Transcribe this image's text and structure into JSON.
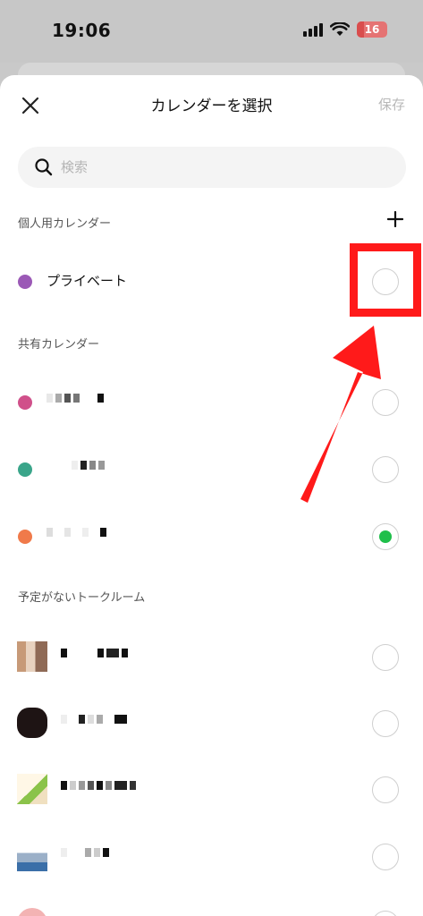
{
  "status_bar": {
    "time": "19:06",
    "battery": "16"
  },
  "header": {
    "title": "カレンダーを選択",
    "save_label": "保存"
  },
  "search": {
    "placeholder": "検索"
  },
  "sections": {
    "personal": "個人用カレンダー",
    "shared": "共有カレンダー",
    "no_schedule": "予定がないトークルーム"
  },
  "personal_calendars": [
    {
      "label": "プライベート",
      "color": "#9b59b6",
      "selected": false
    }
  ],
  "shared_calendar_colors": [
    "#d0508a",
    "#3aa58a",
    "#f07a4a"
  ],
  "shared_selected_index": 2,
  "icons": [
    "close-icon",
    "search-icon",
    "plus-icon",
    "wifi-icon",
    "signal-icon",
    "battery-icon"
  ],
  "annotation_color": "#ff1a1a"
}
